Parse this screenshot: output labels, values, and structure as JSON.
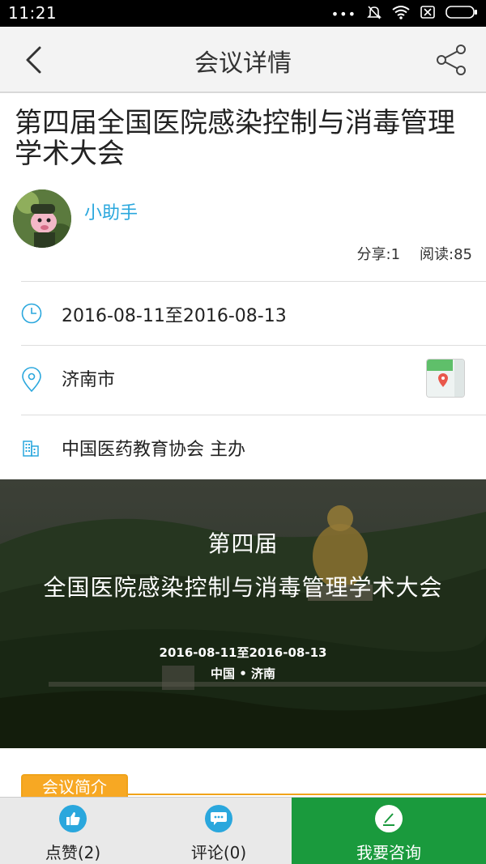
{
  "status_bar": {
    "time": "11:21"
  },
  "header": {
    "title": "会议详情"
  },
  "conference": {
    "title": "第四届全国医院感染控制与消毒管理学术大会"
  },
  "author": {
    "name": "小助手"
  },
  "stats": {
    "share": "分享:1",
    "read": "阅读:85"
  },
  "info": {
    "date": "2016-08-11至2016-08-13",
    "location": "济南市",
    "organizer": "中国医药教育协会 主办"
  },
  "banner": {
    "line1": "第四届",
    "line2": "全国医院感染控制与消毒管理学术大会",
    "date": "2016-08-11至2016-08-13",
    "place": "中国 • 济南"
  },
  "intro_tab": {
    "label": "会议简介"
  },
  "bottom_bar": {
    "like": "点赞(2)",
    "comment": "评论(0)",
    "consult": "我要咨询"
  },
  "colors": {
    "accent_blue": "#2aa7dd",
    "consult_green": "#1a9a3d",
    "intro_orange": "#f7a823"
  }
}
